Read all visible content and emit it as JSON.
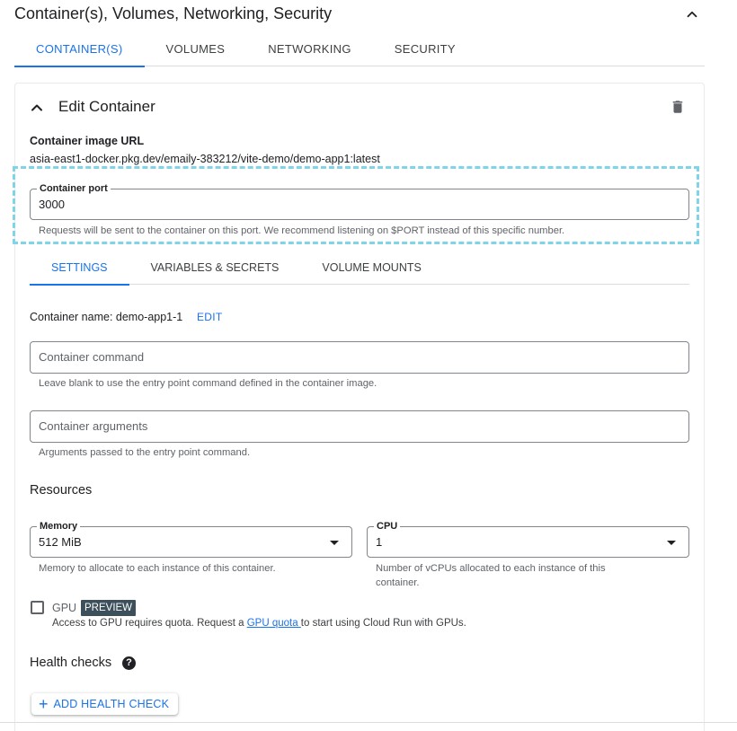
{
  "section": {
    "title": "Container(s), Volumes, Networking, Security"
  },
  "top_tabs": [
    {
      "label": "CONTAINER(S)",
      "active": true
    },
    {
      "label": "VOLUMES",
      "active": false
    },
    {
      "label": "NETWORKING",
      "active": false
    },
    {
      "label": "SECURITY",
      "active": false
    }
  ],
  "edit_container": {
    "title": "Edit Container",
    "image_url_label": "Container image URL",
    "image_url_value": "asia-east1-docker.pkg.dev/emaily-383212/vite-demo/demo-app1:latest",
    "port_label": "Container port",
    "port_value": "3000",
    "port_hint": "Requests will be sent to the container on this port. We recommend listening on $PORT instead of this specific number."
  },
  "sub_tabs": [
    {
      "label": "SETTINGS",
      "active": true
    },
    {
      "label": "VARIABLES & SECRETS",
      "active": false
    },
    {
      "label": "VOLUME MOUNTS",
      "active": false
    }
  ],
  "settings": {
    "container_name": "Container name: demo-app1-1",
    "edit_label": "EDIT",
    "command_placeholder": "Container command",
    "command_hint": "Leave blank to use the entry point command defined in the container image.",
    "args_placeholder": "Container arguments",
    "args_hint": "Arguments passed to the entry point command."
  },
  "resources": {
    "title": "Resources",
    "memory_label": "Memory",
    "memory_value": "512 MiB",
    "memory_hint": "Memory to allocate to each instance of this container.",
    "cpu_label": "CPU",
    "cpu_value": "1",
    "cpu_hint": "Number of vCPUs allocated to each instance of this container."
  },
  "gpu": {
    "label": "GPU",
    "badge": "PREVIEW",
    "hint_before": "Access to GPU requires quota. Request a ",
    "hint_link": "GPU quota ",
    "hint_after": "to start using Cloud Run with GPUs.",
    "checked": false
  },
  "health": {
    "title": "Health checks",
    "help_icon": "?",
    "add_label": "ADD HEALTH CHECK"
  },
  "colors": {
    "accent": "#1a73e8",
    "highlight": "#7fd4ea",
    "badge": "#3c4f5a"
  }
}
